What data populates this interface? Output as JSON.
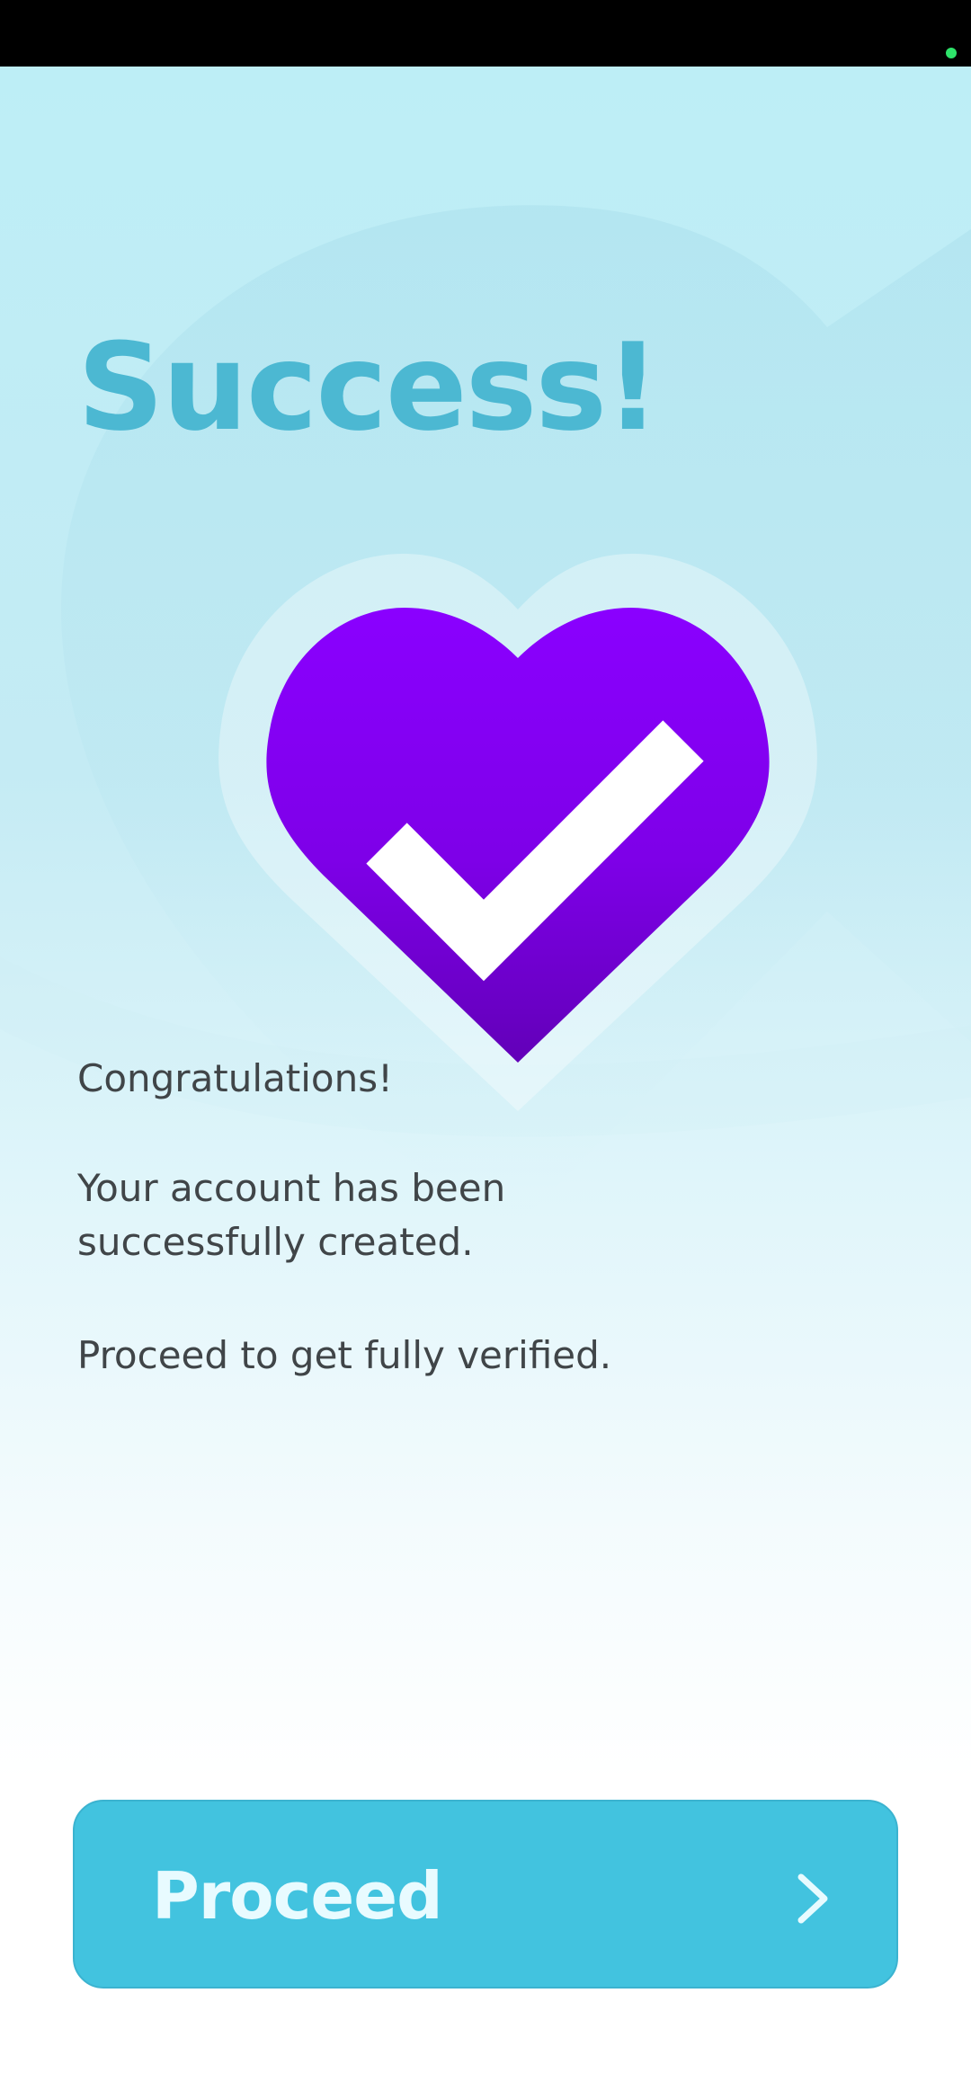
{
  "status_bar": {
    "indicator_color": "#2ee36a"
  },
  "screen": {
    "title": "Success!",
    "icon": "heart-checkmark-icon",
    "heart_color": "#8400f0",
    "messages": {
      "congrats": "Congratulations!",
      "account": "Your account has been successfully created.",
      "next": "Proceed to get fully verified."
    },
    "proceed_button": {
      "label": "Proceed",
      "icon": "chevron-right-icon",
      "color": "#42c3df"
    }
  }
}
